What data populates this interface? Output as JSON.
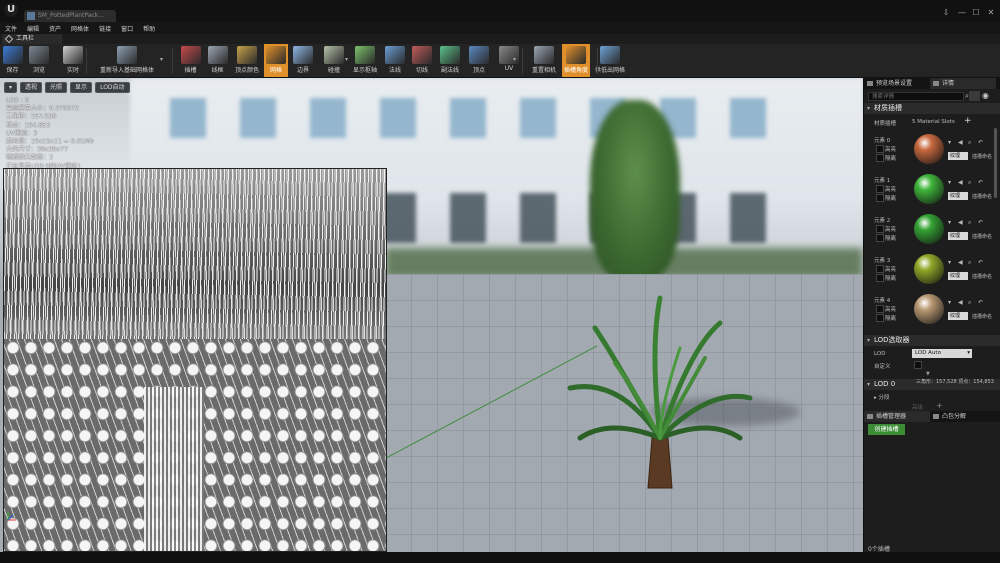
{
  "window": {
    "tab_title": "SM_PottedPlantPack...",
    "controls": [
      "⇩",
      "—",
      "☐",
      "✕"
    ]
  },
  "menu": [
    "文件",
    "编辑",
    "资产",
    "网格体",
    "链接",
    "窗口",
    "帮助"
  ],
  "toolbar_tab": "工具栏",
  "toolbar": [
    {
      "label": "保存",
      "icon": "save-icon",
      "color": "#3a7bd5"
    },
    {
      "label": "浏览",
      "icon": "browse-icon",
      "color": "#7c8793"
    },
    {
      "label": "实时",
      "icon": "realtime-icon",
      "color": "#d0d0d0"
    },
    {
      "label": "重新导入基础网格体",
      "icon": "reimport-icon",
      "color": "#8ea1b3"
    },
    {
      "label": "插槽",
      "icon": "socket-icon",
      "color": "#c84a4a"
    },
    {
      "label": "线框",
      "icon": "wireframe-icon",
      "color": "#9aa6b2"
    },
    {
      "label": "顶点颜色",
      "icon": "vertex-color-icon",
      "color": "#c7a24a"
    },
    {
      "label": "网格",
      "icon": "grid-icon",
      "color": "#e0902a",
      "active": true
    },
    {
      "label": "边界",
      "icon": "bounds-icon",
      "color": "#8fb7e6"
    },
    {
      "label": "碰撞",
      "icon": "collision-icon",
      "color": "#b5c2a8"
    },
    {
      "label": "显示枢轴",
      "icon": "pivot-icon",
      "color": "#7cc36b"
    },
    {
      "label": "法线",
      "icon": "normals-icon",
      "color": "#6b9ed6"
    },
    {
      "label": "切线",
      "icon": "tangents-icon",
      "color": "#c15b5b"
    },
    {
      "label": "副法线",
      "icon": "binormals-icon",
      "color": "#5bc18a"
    },
    {
      "label": "顶点",
      "icon": "vertices-icon",
      "color": "#5b89c1"
    },
    {
      "label": "UV",
      "icon": "uv-icon",
      "color": "#8a8a8a"
    },
    {
      "label": "重置相机",
      "icon": "reset-camera-icon",
      "color": "#9aa6b2"
    },
    {
      "label": "插槽角度",
      "icon": "socket-angle-icon",
      "color": "#e0902a",
      "active": true
    },
    {
      "label": "供低出网格",
      "icon": "layers-icon",
      "color": "#6fa3d6"
    }
  ],
  "viewport": {
    "buttons": [
      "透视",
      "光照",
      "显示",
      "LOD自动"
    ],
    "stats": [
      "LOD : 0",
      "当前屏幕大小：0.370672",
      "三角形：157,528",
      "顶点：154,853",
      "UV通道：3",
      "近似值：15x15x11 = 0.01Mb",
      "大约尺寸：39x39x77",
      "碰撞图元数量：2",
      "正在显示LOD 0的UV通道1"
    ]
  },
  "right_panel": {
    "tabs": [
      "预览场景设置",
      "详情"
    ],
    "search_placeholder": "搜索详情",
    "material_section": "材质插槽",
    "material_slots_label": "材质插槽",
    "material_slots_count": "5 Material Slots",
    "elements": [
      {
        "name": "元素 0",
        "highlight": "高亮",
        "isolate": "隔离",
        "texture": "纹理",
        "slot": "插槽命名",
        "color": "#c8693f"
      },
      {
        "name": "元素 1",
        "highlight": "高亮",
        "isolate": "隔离",
        "texture": "纹理",
        "slot": "插槽命名",
        "color": "#3fb53a"
      },
      {
        "name": "元素 2",
        "highlight": "高亮",
        "isolate": "隔离",
        "texture": "纹理",
        "slot": "插槽命名",
        "color": "#34a334"
      },
      {
        "name": "元素 3",
        "highlight": "高亮",
        "isolate": "隔离",
        "texture": "纹理",
        "slot": "插槽命名",
        "color": "#8fa928"
      },
      {
        "name": "元素 4",
        "highlight": "高亮",
        "isolate": "隔离",
        "texture": "纹理",
        "slot": "插槽命名",
        "color": "#b99a73"
      }
    ],
    "lod_picker_section": "LOD选取器",
    "lod_label": "LOD",
    "lod_value": "LOD Auto",
    "custom_label": "自定义",
    "lod0_section": "LOD 0",
    "lod0_stats": "三角形：157,528   顶点：154,853",
    "sections_label": "分段",
    "faint_label": "高级",
    "bottom_tabs": [
      "插槽管理器",
      "凸包分解"
    ],
    "create_socket": "创建插槽",
    "socket_count": "0个插槽"
  }
}
